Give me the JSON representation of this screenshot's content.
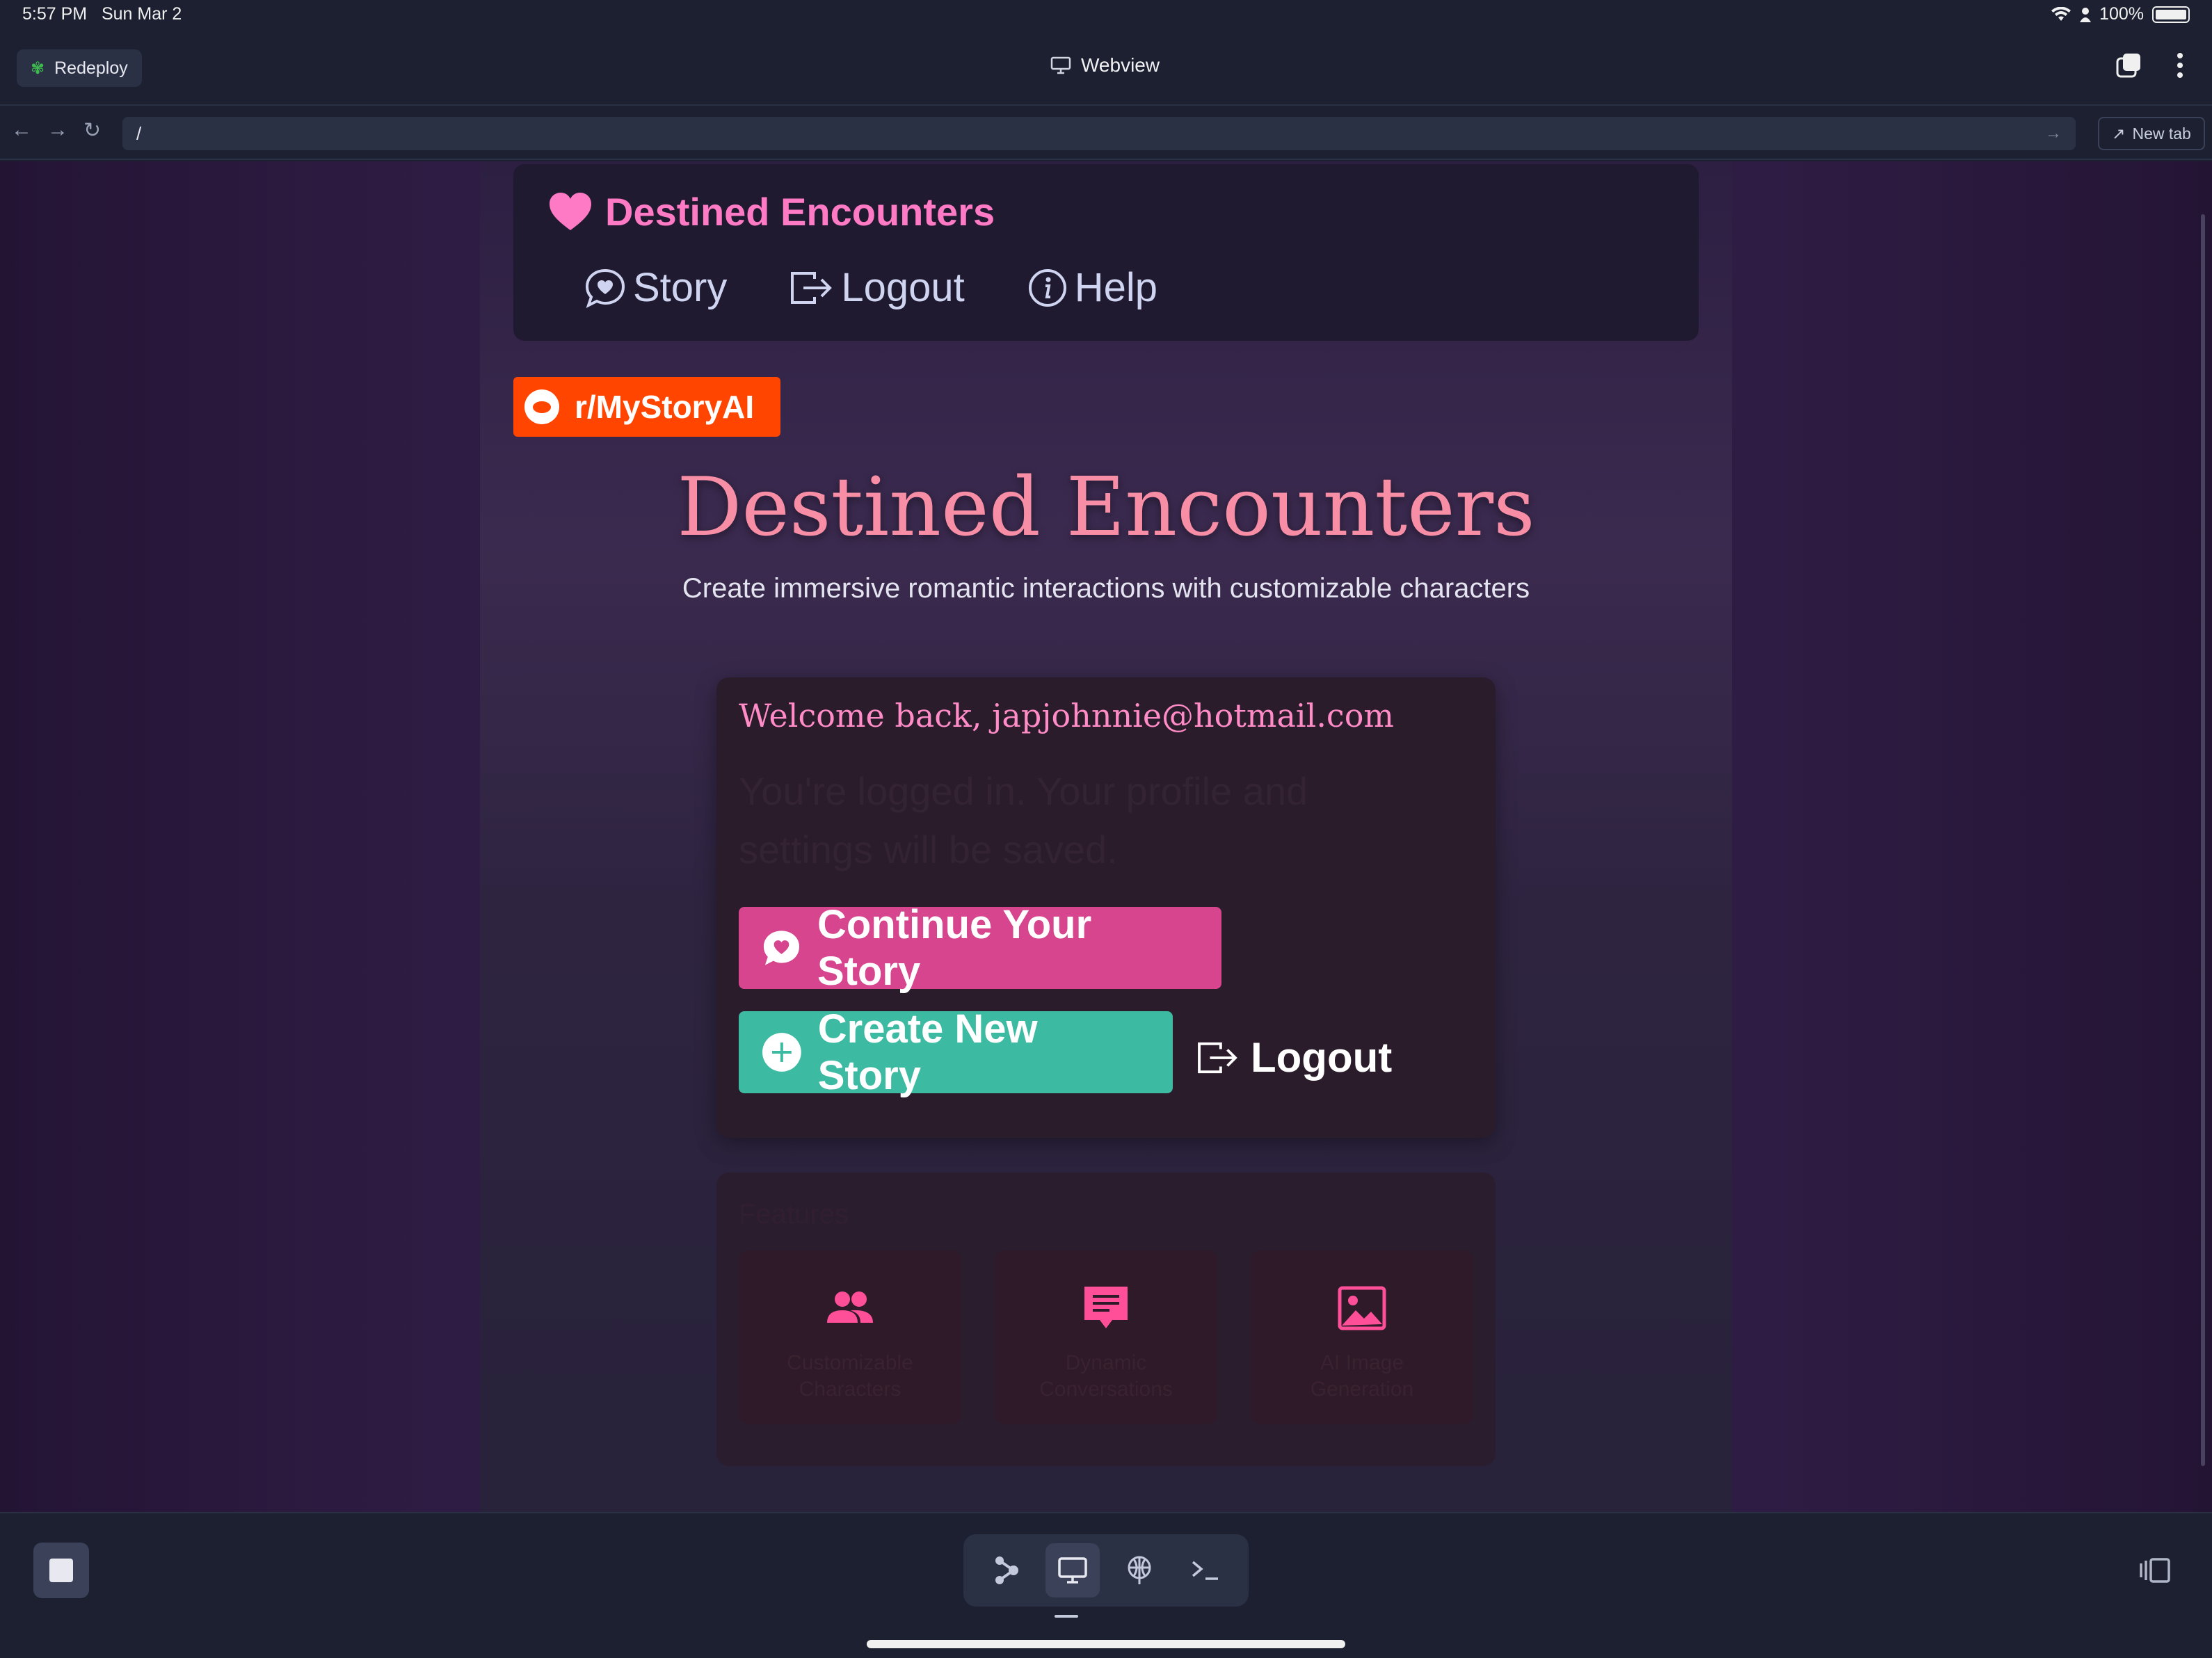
{
  "status_bar": {
    "time": "5:57 PM",
    "date": "Sun Mar 2",
    "battery": "100%"
  },
  "toolbar": {
    "redeploy_label": "Redeploy",
    "webview_title": "Webview"
  },
  "url_bar": {
    "url": "/",
    "new_tab_label": "New tab"
  },
  "site": {
    "brand": "Destined Encounters",
    "nav": [
      {
        "label": "Story",
        "icon": "chat-heart-icon"
      },
      {
        "label": "Logout",
        "icon": "logout-icon"
      },
      {
        "label": "Help",
        "icon": "info-icon"
      }
    ],
    "reddit_badge": "r/MyStoryAI",
    "hero_title": "Destined Encounters",
    "hero_subtitle": "Create immersive romantic interactions with customizable characters",
    "welcome": "Welcome back, japjohnnie@hotmail.com",
    "welcome_faint": "You're logged in. Your profile and settings will be saved.",
    "buttons": {
      "continue": "Continue Your Story",
      "create": "Create New Story",
      "logout": "Logout"
    },
    "features_heading": "Features",
    "features": [
      {
        "label": "Customizable Characters",
        "icon": "people-icon"
      },
      {
        "label": "Dynamic Conversations",
        "icon": "message-icon"
      },
      {
        "label": "AI Image Generation",
        "icon": "image-icon"
      }
    ]
  },
  "colors": {
    "brand_pink": "#ff7ac4",
    "hero_pink": "#f78ea6",
    "continue_button": "#d6458d",
    "create_button": "#3dbaa2",
    "reddit_orange": "#ff4500"
  }
}
